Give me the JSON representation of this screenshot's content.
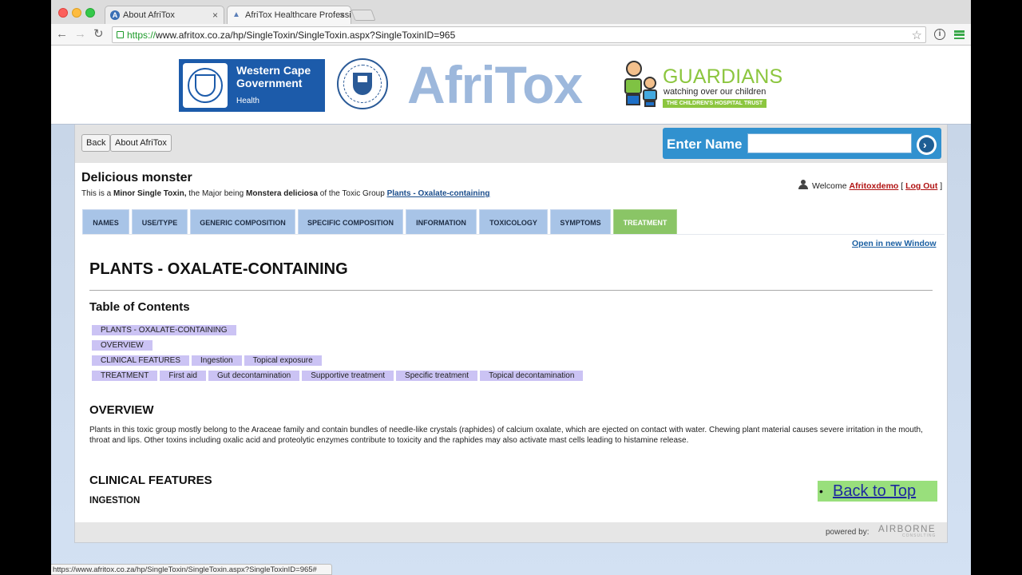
{
  "browser": {
    "tabs": [
      {
        "label": "About AfriTox"
      },
      {
        "label": "AfriTox Healthcare Professi"
      }
    ],
    "url_scheme": "https://",
    "url_rest": "www.afritox.co.za/hp/SingleToxin/SingleToxin.aspx?SingleToxinID=965",
    "status_url": "https://www.afritox.co.za/hp/SingleToxin/SingleToxin.aspx?SingleToxinID=965#"
  },
  "banner": {
    "wcg_line1": "Western Cape",
    "wcg_line2": "Government",
    "wcg_line3": "Health",
    "afritox": "AfriTox",
    "guardians_title": "GUARDIANS",
    "guardians_sub": "watching over our children",
    "guardians_strip": "THE CHILDREN'S HOSPITAL TRUST"
  },
  "top_buttons": {
    "back": "Back",
    "about": "About AfriTox"
  },
  "search": {
    "label": "Enter Name",
    "value": "",
    "go": "›"
  },
  "toxin": {
    "title": "Delicious monster",
    "sub_prefix": "This is a ",
    "sub_minor": "Minor Single Toxin,",
    "sub_mid": " the Major being ",
    "sub_major": "Monstera deliciosa",
    "sub_group_prefix": " of the Toxic Group ",
    "sub_group_link": "Plants - Oxalate-containing"
  },
  "user": {
    "welcome": "Welcome ",
    "username": "Afritoxdemo",
    "bracket_open": " [ ",
    "logout": "Log Out",
    "bracket_close": " ]"
  },
  "page_tabs": [
    {
      "label": "NAMES",
      "active": false
    },
    {
      "label": "USE/TYPE",
      "active": false
    },
    {
      "label": "GENERIC COMPOSITION",
      "active": false
    },
    {
      "label": "SPECIFIC COMPOSITION",
      "active": false
    },
    {
      "label": "INFORMATION",
      "active": false
    },
    {
      "label": "TOXICOLOGY",
      "active": false
    },
    {
      "label": "SYMPTOMS",
      "active": false
    },
    {
      "label": "TREATMENT",
      "active": true
    }
  ],
  "open_new_window": "Open in new Window",
  "doc": {
    "heading": "PLANTS - OXALATE-CONTAINING",
    "toc_title": "Table of Contents",
    "toc_rows": [
      [
        "PLANTS - OXALATE-CONTAINING"
      ],
      [
        "OVERVIEW"
      ],
      [
        "CLINICAL FEATURES",
        "Ingestion",
        "Topical exposure"
      ],
      [
        "TREATMENT",
        "First aid",
        "Gut decontamination",
        "Supportive treatment",
        "Specific treatment",
        "Topical decontamination"
      ]
    ],
    "overview_title": "OVERVIEW",
    "overview_text": "Plants in this toxic group mostly belong to the Araceae family and contain bundles of needle-like crystals (raphides) of calcium oxalate, which are ejected on contact with water. Chewing plant material causes severe irritation in the mouth, throat and lips. Other toxins including oxalic acid and proteolytic enzymes contribute to toxicity and the raphides may also activate mast cells leading to histamine release.",
    "clinical_title": "CLINICAL FEATURES",
    "ingestion_title": "INGESTION",
    "back_to_top": "Back to Top"
  },
  "footer": {
    "powered_by": "powered by:",
    "airborne": "AIRBORNE",
    "airborne_sub": "CONSULTING"
  }
}
